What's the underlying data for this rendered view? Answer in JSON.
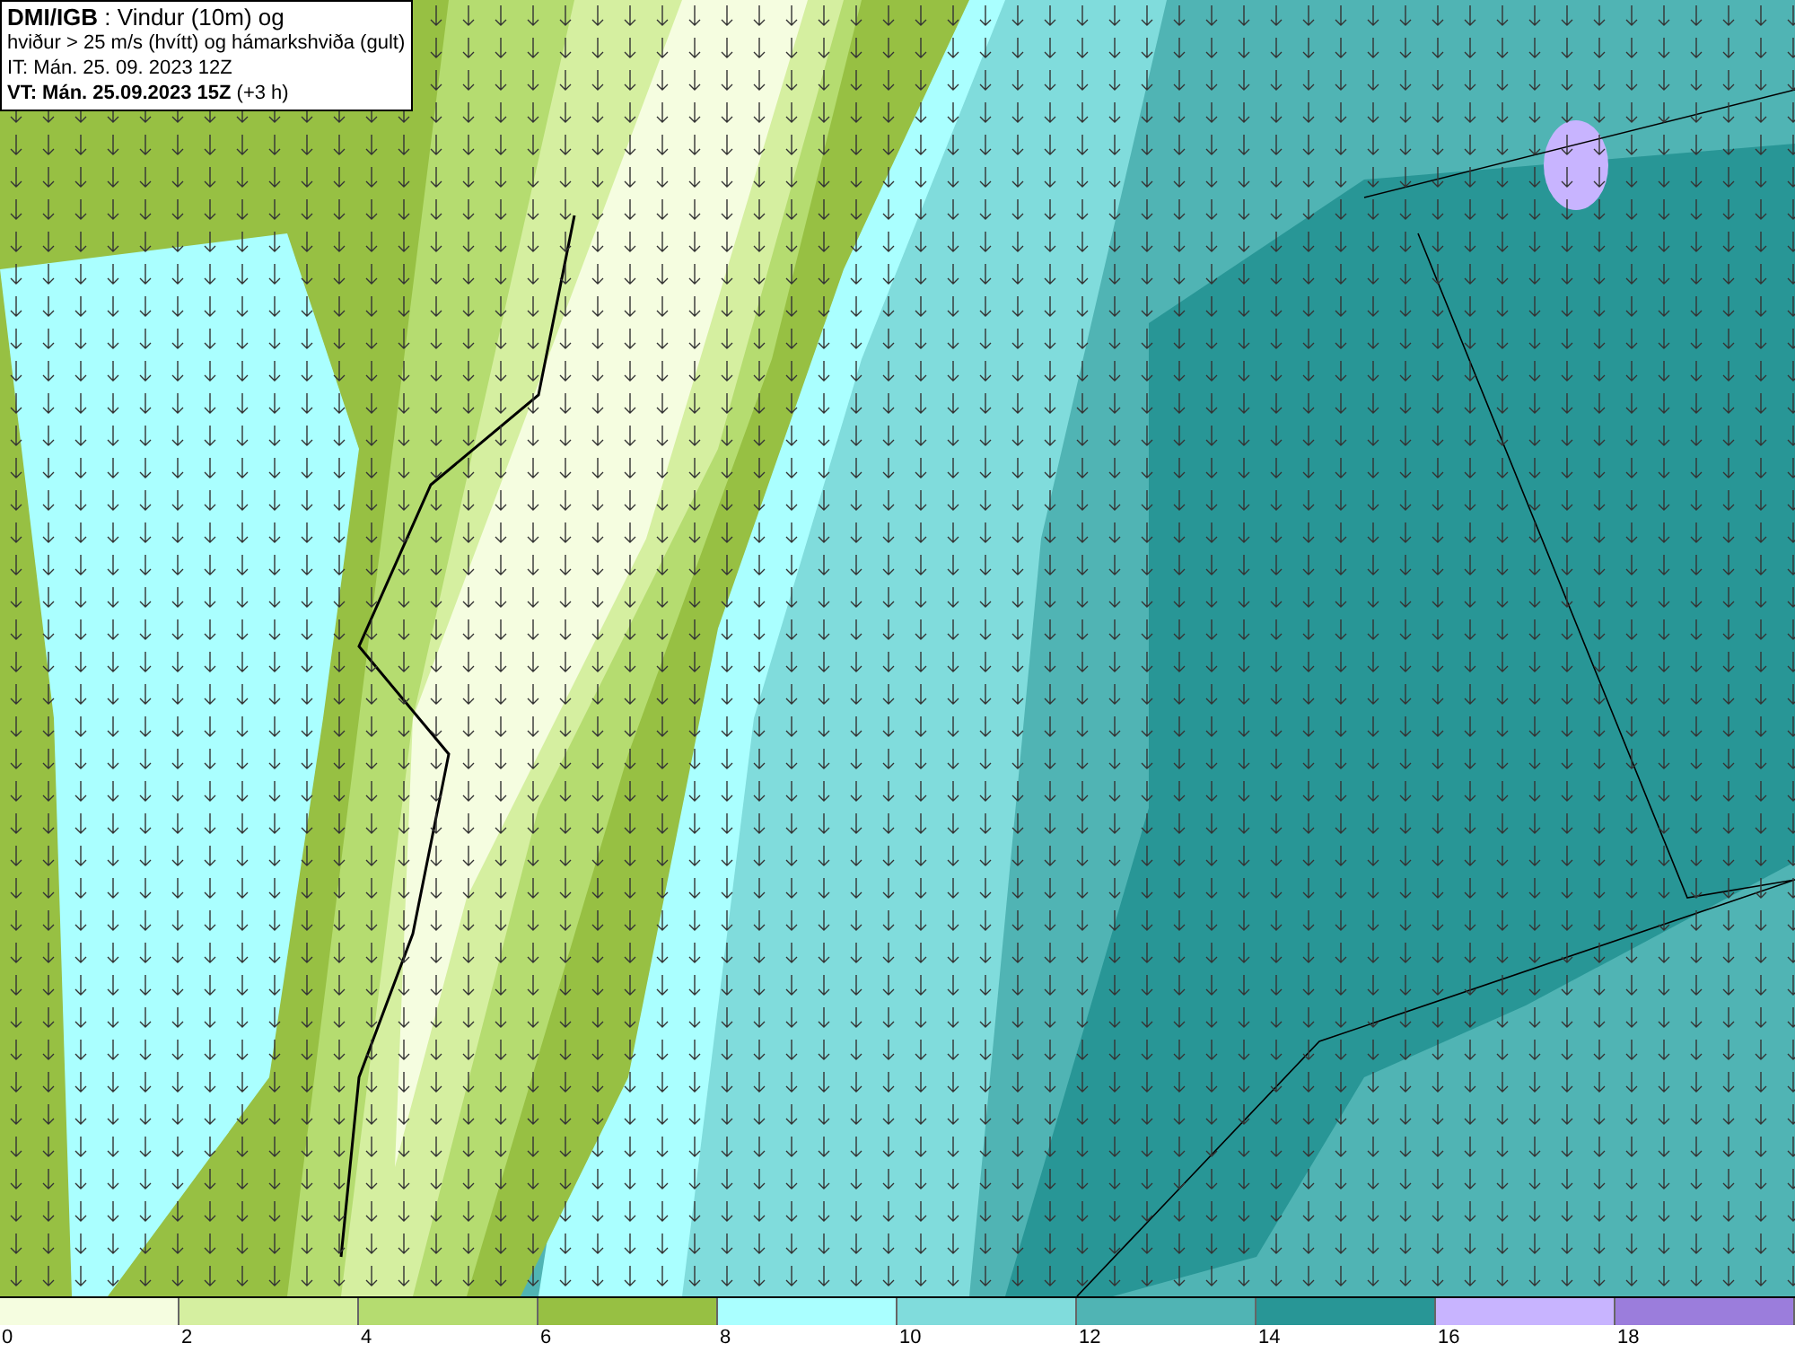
{
  "title_box": {
    "lines": [
      "**DMI/IGB** : Vindur (10m) og",
      "hviður > 25 m/s (hvítt) og hámarkshviða (gult)",
      "IT: Mán. 25. 09. 2023 12Z",
      "**VT: Mán. 25.09.2023 15Z** (+3 h)"
    ]
  },
  "legend": {
    "swatches": [
      {
        "color": "#f5fde0"
      },
      {
        "color": "#d5efa0"
      },
      {
        "color": "#b5dc70"
      },
      {
        "color": "#97c043"
      },
      {
        "color": "#aaffff"
      },
      {
        "color": "#80dcdc"
      },
      {
        "color": "#50b4b4"
      },
      {
        "color": "#289696"
      },
      {
        "color": "#c8b4ff"
      },
      {
        "color": "#9b7ddc"
      }
    ],
    "ticks": [
      "0",
      "2",
      "4",
      "6",
      "8",
      "10",
      "12",
      "14",
      "16",
      "18"
    ]
  }
}
